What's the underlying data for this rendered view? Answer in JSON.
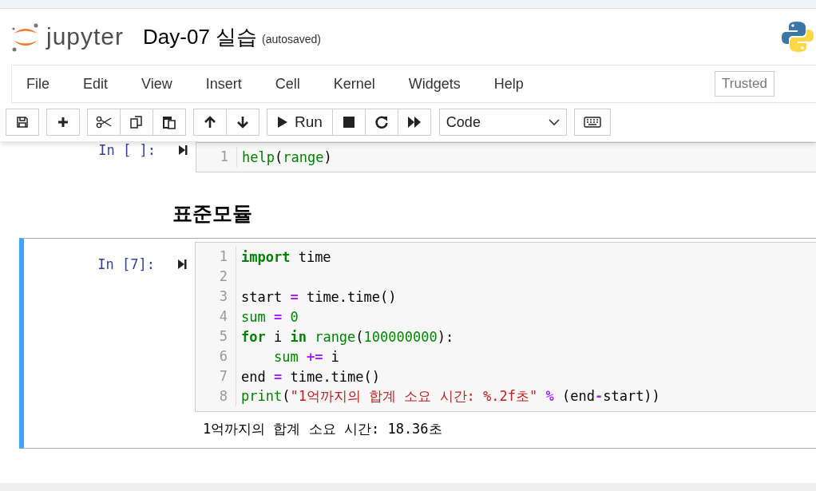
{
  "header": {
    "logo_text": "jupyter",
    "title": "Day-07 실습",
    "save_status": "(autosaved)"
  },
  "menu": [
    "File",
    "Edit",
    "View",
    "Insert",
    "Cell",
    "Kernel",
    "Widgets",
    "Help"
  ],
  "trusted": "Trusted",
  "toolbar": {
    "run_label": "Run",
    "cell_type": "Code"
  },
  "cells": [
    {
      "kind": "code",
      "selected": false,
      "prompt": "In [ ]:",
      "lines": [
        {
          "n": "1",
          "tokens": [
            {
              "kind": "bi",
              "t": "help"
            },
            {
              "kind": "p",
              "t": "("
            },
            {
              "kind": "bi",
              "t": "range"
            },
            {
              "kind": "p",
              "t": ")"
            }
          ]
        }
      ]
    },
    {
      "kind": "heading",
      "selected": false,
      "text": "표준모듈"
    },
    {
      "kind": "code",
      "selected": true,
      "prompt": "In [7]:",
      "lines": [
        {
          "n": "1",
          "tokens": [
            {
              "kind": "kw",
              "t": "import"
            },
            {
              "kind": "p",
              "t": " time"
            }
          ]
        },
        {
          "n": "2"
        },
        {
          "n": "3",
          "tokens": [
            {
              "kind": "p",
              "t": "start "
            },
            {
              "kind": "op",
              "t": "="
            },
            {
              "kind": "p",
              "t": " time.time()"
            }
          ]
        },
        {
          "n": "4",
          "tokens": [
            {
              "kind": "bi",
              "t": "sum"
            },
            {
              "kind": "op",
              "t": " = "
            },
            {
              "kind": "num",
              "t": "0"
            }
          ]
        },
        {
          "n": "5",
          "tokens": [
            {
              "kind": "kw",
              "t": "for"
            },
            {
              "kind": "p",
              "t": " i "
            },
            {
              "kind": "kw",
              "t": "in "
            },
            {
              "kind": "bi",
              "t": "range"
            },
            {
              "kind": "p",
              "t": "("
            },
            {
              "kind": "num",
              "t": "100000000"
            },
            {
              "kind": "p",
              "t": "):"
            }
          ]
        },
        {
          "n": "6",
          "tokens": [
            {
              "kind": "bi",
              "t": "    sum"
            },
            {
              "kind": "op",
              "t": " += "
            },
            {
              "kind": "p",
              "t": "i"
            }
          ]
        },
        {
          "n": "7",
          "tokens": [
            {
              "kind": "p",
              "t": "end "
            },
            {
              "kind": "op",
              "t": "="
            },
            {
              "kind": "p",
              "t": " time.time()"
            }
          ]
        },
        {
          "n": "8",
          "tokens": [
            {
              "kind": "bi",
              "t": "print"
            },
            {
              "kind": "p",
              "t": "("
            },
            {
              "kind": "str",
              "t": "\"1억까지의 합계 소요 시간: %.2f초\""
            },
            {
              "kind": "op",
              "t": " % "
            },
            {
              "kind": "p",
              "t": "(end"
            },
            {
              "kind": "op",
              "t": "-"
            },
            {
              "kind": "p",
              "t": "start))"
            }
          ]
        }
      ],
      "output": "1억까지의 합계 소요 시간: 18.36초"
    }
  ]
}
